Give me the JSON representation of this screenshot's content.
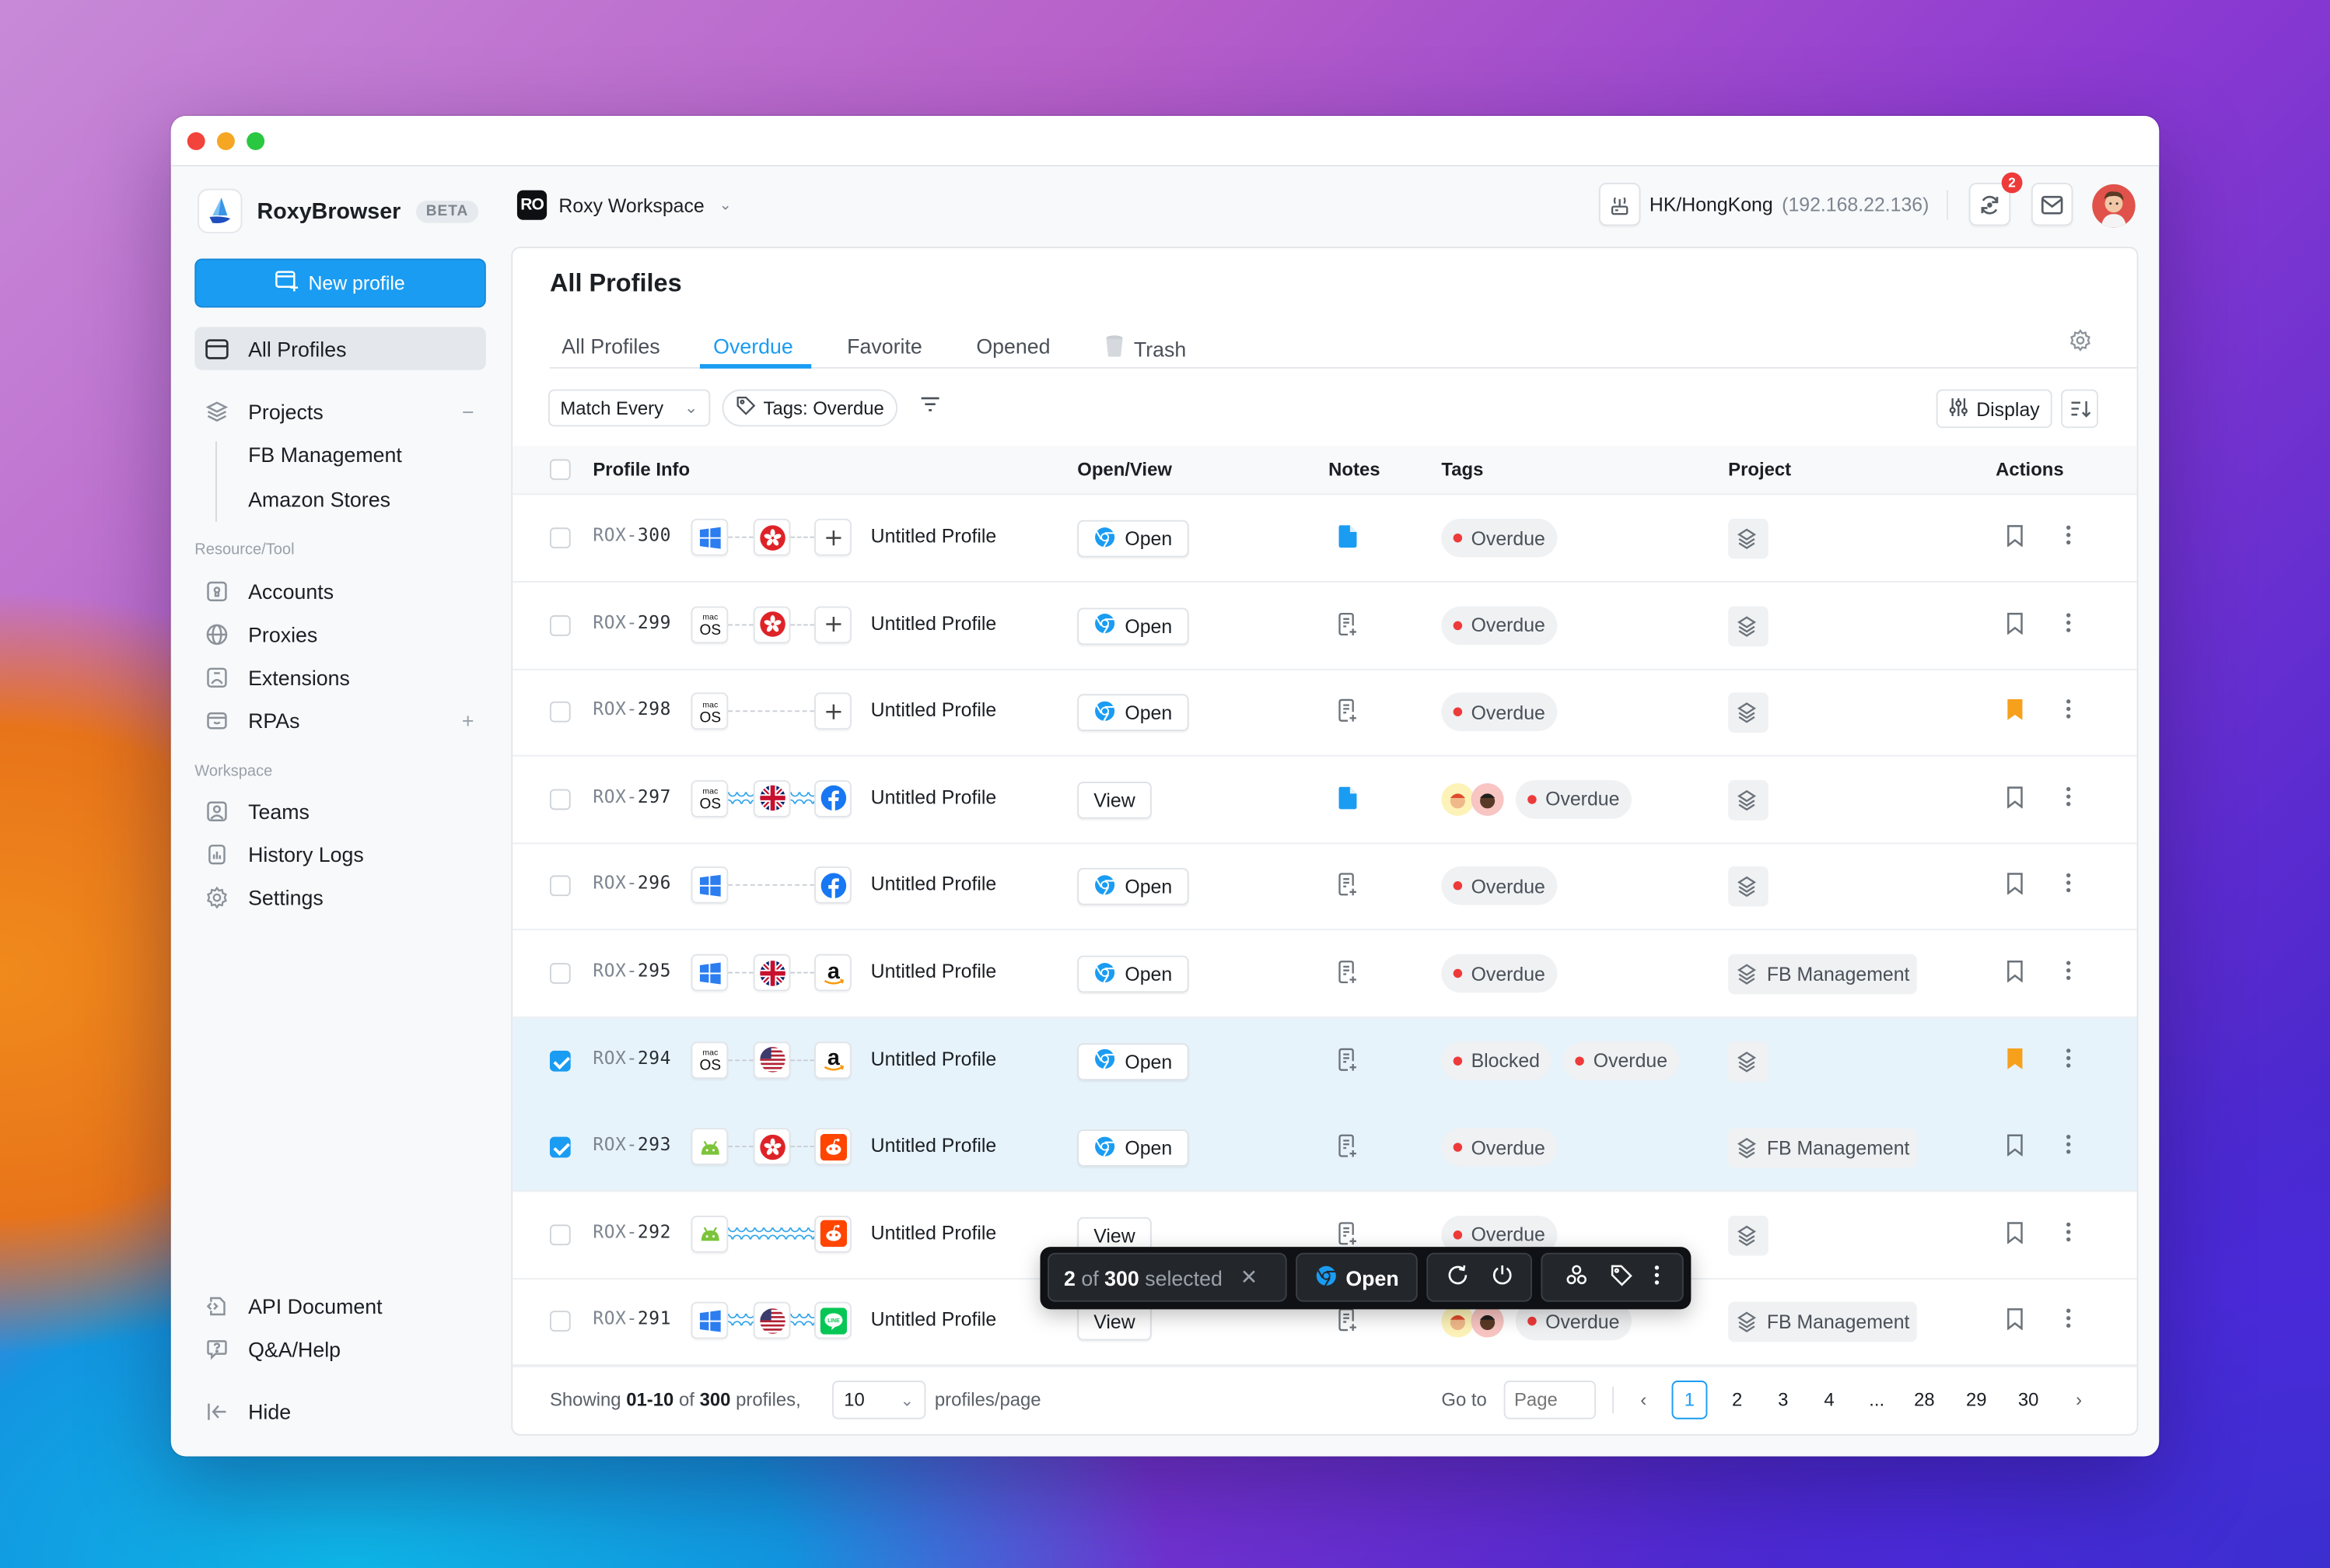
{
  "window": {
    "app_name": "RoxyBrowser",
    "app_badge": "BETA"
  },
  "sidebar": {
    "new_profile_label": "New profile",
    "all_profiles_label": "All Profiles",
    "projects_label": "Projects",
    "projects_collapse": "−",
    "project_items": [
      "FB Management",
      "Amazon Stores"
    ],
    "resource_section": "Resource/Tool",
    "resource_items": [
      {
        "label": "Accounts",
        "icon": "account-lock-icon"
      },
      {
        "label": "Proxies",
        "icon": "globe-icon"
      },
      {
        "label": "Extensions",
        "icon": "extension-icon"
      },
      {
        "label": "RPAs",
        "icon": "rpa-icon",
        "trail": "+"
      }
    ],
    "workspace_section": "Workspace",
    "workspace_items": [
      {
        "label": "Teams",
        "icon": "team-icon"
      },
      {
        "label": "History Logs",
        "icon": "chart-log-icon"
      },
      {
        "label": "Settings",
        "icon": "gear-icon"
      }
    ],
    "bottom_items": [
      {
        "label": "API Document",
        "icon": "code-doc-icon"
      },
      {
        "label": "Q&A/Help",
        "icon": "help-bubble-icon"
      }
    ],
    "hide_label": "Hide"
  },
  "header": {
    "workspace_badge": "RO",
    "workspace_name": "Roxy Workspace",
    "proxy_location": "HK/HongKong",
    "proxy_ip": "(192.168.22.136)",
    "sync_badge_count": "2"
  },
  "main": {
    "title": "All Profiles",
    "tabs": [
      {
        "label": "All Profiles",
        "active": false
      },
      {
        "label": "Overdue",
        "active": true
      },
      {
        "label": "Favorite",
        "active": false
      },
      {
        "label": "Opened",
        "active": false
      },
      {
        "label": "Trash",
        "active": false,
        "icon": "trash-icon"
      }
    ],
    "filter_match": "Match Every",
    "filter_tag_chip": "Tags: Overdue",
    "display_label": "Display",
    "columns": [
      "Profile Info",
      "Open/View",
      "Notes",
      "Tags",
      "Project",
      "Actions"
    ]
  },
  "rows": [
    {
      "prefix": "ROX-",
      "num": "300",
      "checked": false,
      "os": "windows",
      "proxy": "hk",
      "site": "add",
      "link": "dotted",
      "name": "Untitled Profile",
      "action": "Open",
      "note": "filled",
      "avatars": [],
      "tags": [
        "Overdue"
      ],
      "project": "",
      "bookmarked": false
    },
    {
      "prefix": "ROX-",
      "num": "299",
      "checked": false,
      "os": "macos",
      "proxy": "hk",
      "site": "add",
      "link": "dotted",
      "name": "Untitled Profile",
      "action": "Open",
      "note": "add",
      "avatars": [],
      "tags": [
        "Overdue"
      ],
      "project": "",
      "bookmarked": false
    },
    {
      "prefix": "ROX-",
      "num": "298",
      "checked": false,
      "os": "macos",
      "proxy": "",
      "site": "add",
      "link": "dotted",
      "name": "Untitled Profile",
      "action": "Open",
      "note": "add",
      "avatars": [],
      "tags": [
        "Overdue"
      ],
      "project": "",
      "bookmarked": true
    },
    {
      "prefix": "ROX-",
      "num": "297",
      "checked": false,
      "os": "macos",
      "proxy": "uk",
      "site": "facebook",
      "link": "wave",
      "name": "Untitled Profile",
      "action": "View",
      "note": "filled",
      "avatars": [
        "memoji-red-cap",
        "memoji-mask"
      ],
      "tags": [
        "Overdue"
      ],
      "project": "",
      "bookmarked": false
    },
    {
      "prefix": "ROX-",
      "num": "296",
      "checked": false,
      "os": "windows",
      "proxy": "",
      "site": "facebook",
      "link": "dotted",
      "name": "Untitled Profile",
      "action": "Open",
      "note": "add",
      "avatars": [],
      "tags": [
        "Overdue"
      ],
      "project": "",
      "bookmarked": false
    },
    {
      "prefix": "ROX-",
      "num": "295",
      "checked": false,
      "os": "windows",
      "proxy": "uk",
      "site": "amazon",
      "link": "dotted",
      "name": "Untitled Profile",
      "action": "Open",
      "note": "add",
      "avatars": [],
      "tags": [
        "Overdue"
      ],
      "project": "FB Management",
      "bookmarked": false
    },
    {
      "prefix": "ROX-",
      "num": "294",
      "checked": true,
      "os": "macos",
      "proxy": "us",
      "site": "amazon",
      "link": "dotted",
      "name": "Untitled Profile",
      "action": "Open",
      "note": "add",
      "avatars": [],
      "tags": [
        "Blocked",
        "Overdue"
      ],
      "project": "",
      "bookmarked": true
    },
    {
      "prefix": "ROX-",
      "num": "293",
      "checked": true,
      "os": "android",
      "proxy": "hk",
      "site": "reddit",
      "link": "dotted",
      "name": "Untitled Profile",
      "action": "Open",
      "note": "add",
      "avatars": [],
      "tags": [
        "Overdue"
      ],
      "project": "FB Management",
      "bookmarked": false
    },
    {
      "prefix": "ROX-",
      "num": "292",
      "checked": false,
      "os": "android",
      "proxy": "",
      "site": "reddit",
      "link": "wave",
      "name": "Untitled Profile",
      "action": "View",
      "note": "add",
      "avatars": [],
      "tags": [
        "Overdue"
      ],
      "project": "",
      "bookmarked": false
    },
    {
      "prefix": "ROX-",
      "num": "291",
      "checked": false,
      "os": "windows",
      "proxy": "us",
      "site": "line",
      "link": "wave",
      "name": "Untitled Profile",
      "action": "View",
      "note": "add",
      "avatars": [
        "memoji-red-cap",
        "memoji-mask"
      ],
      "tags": [
        "Overdue"
      ],
      "project": "FB Management",
      "bookmarked": false
    }
  ],
  "footer": {
    "showing_prefix": "Showing",
    "showing_range": "01-10",
    "showing_of": "of",
    "showing_total": "300",
    "showing_suffix": "profiles,",
    "per_page": "10",
    "per_page_label": "profiles/page",
    "goto_label": "Go to",
    "page_placeholder": "Page",
    "pages": [
      "1",
      "2",
      "3",
      "4",
      "...",
      "28",
      "29",
      "30"
    ],
    "current_page": "1"
  },
  "bulk_bar": {
    "selected_count": "2",
    "of_label": "of",
    "total": "300",
    "selected_label": "selected",
    "open_label": "Open"
  },
  "colors": {
    "accent": "#1a9cf2",
    "overdue_dot": "#ee3a3a",
    "bookmark_active": "#f7a01c",
    "selected_row_bg": "#e7f3fb"
  }
}
